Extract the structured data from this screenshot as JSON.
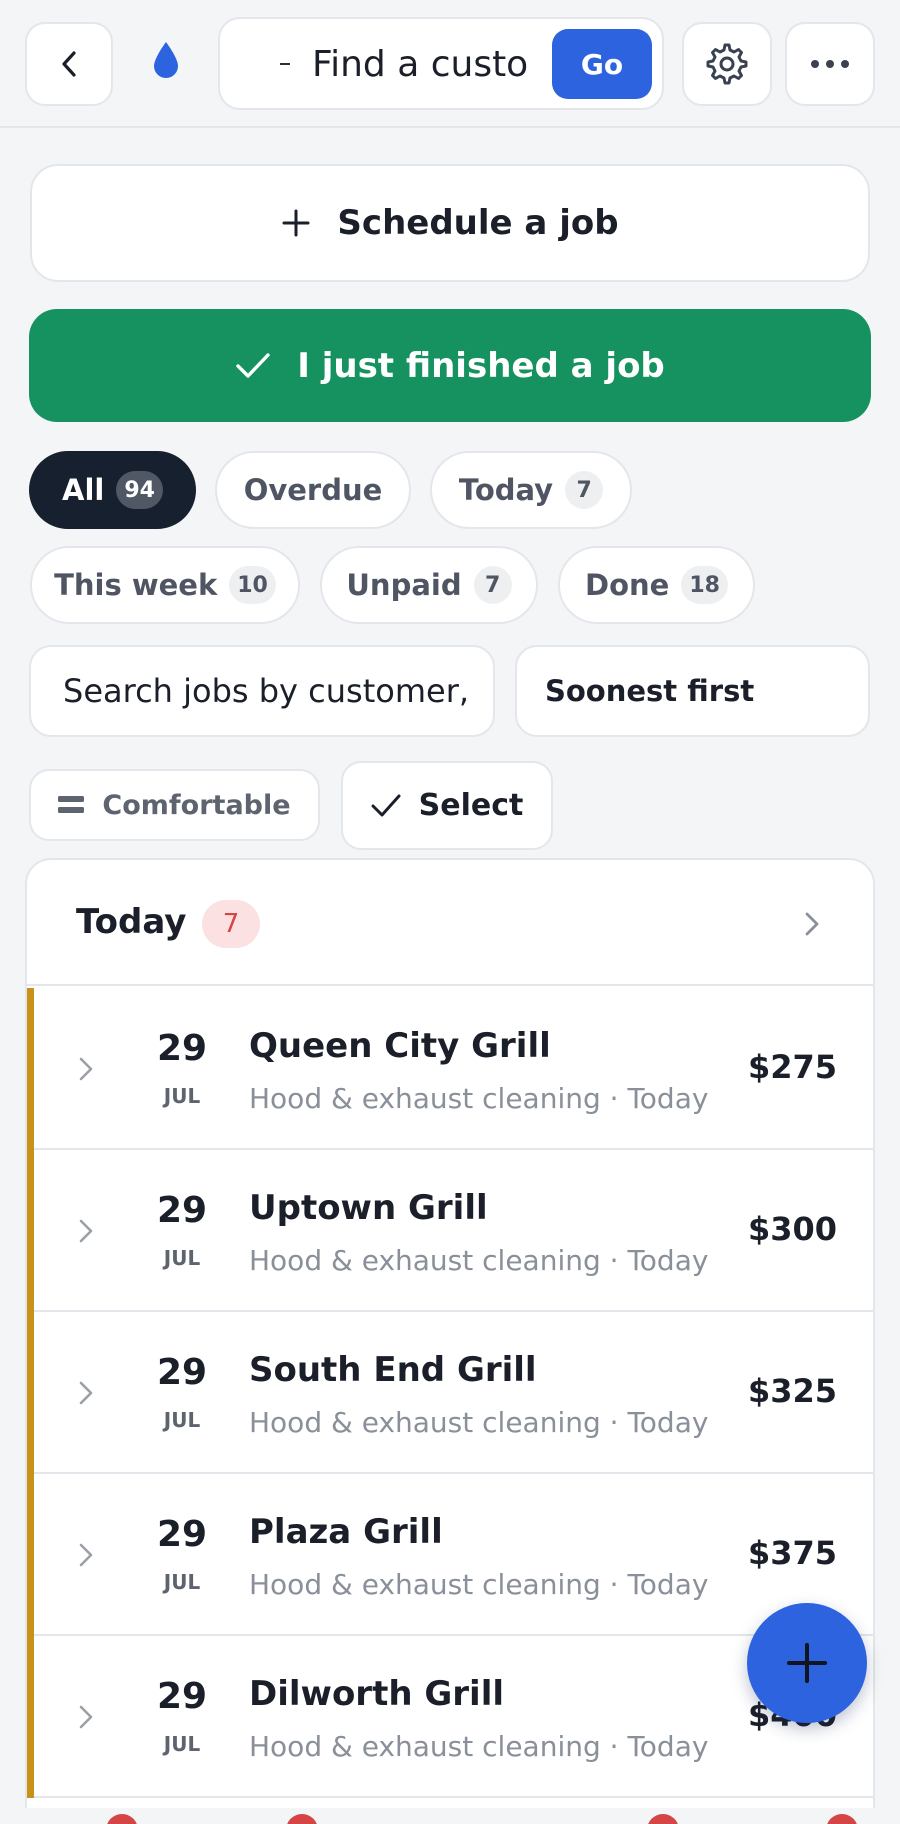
{
  "topbar": {
    "search_value": "Find a custo",
    "go_label": "Go",
    "icons": {
      "back": "chevron-left-icon",
      "logo": "water-drop-icon",
      "settings": "gear-icon",
      "more": "more-horizontal-icon"
    }
  },
  "actions": {
    "schedule_label": "Schedule a job",
    "finished_label": "I just finished a job"
  },
  "filters": [
    {
      "label": "All",
      "count": "94",
      "active": true
    },
    {
      "label": "Overdue",
      "count": "",
      "active": false
    },
    {
      "label": "Today",
      "count": "7",
      "active": false
    },
    {
      "label": "This week",
      "count": "10",
      "active": false
    },
    {
      "label": "Unpaid",
      "count": "7",
      "active": false
    },
    {
      "label": "Done",
      "count": "18",
      "active": false
    }
  ],
  "search": {
    "text": "Search jobs by customer,"
  },
  "sort": {
    "selected": "Soonest first"
  },
  "view": {
    "density_label": "Comfortable",
    "select_label": "Select"
  },
  "section": {
    "title": "Today",
    "count": "7"
  },
  "jobs": [
    {
      "day": "29",
      "month": "JUL",
      "name": "Queen City Grill",
      "meta": "Hood & exhaust cleaning · Today",
      "price": "$275"
    },
    {
      "day": "29",
      "month": "JUL",
      "name": "Uptown Grill",
      "meta": "Hood & exhaust cleaning · Today",
      "price": "$300"
    },
    {
      "day": "29",
      "month": "JUL",
      "name": "South End Grill",
      "meta": "Hood & exhaust cleaning · Today",
      "price": "$325"
    },
    {
      "day": "29",
      "month": "JUL",
      "name": "Plaza Grill",
      "meta": "Hood & exhaust cleaning · Today",
      "price": "$375"
    },
    {
      "day": "29",
      "month": "JUL",
      "name": "Dilworth Grill",
      "meta": "Hood & exhaust cleaning · Today",
      "price": "$400"
    }
  ],
  "colors": {
    "accent_blue": "#2d63de",
    "success_green": "#15925f",
    "chip_active": "#17202e",
    "row_accent": "#c8911a",
    "badge_red": "#d64545"
  }
}
